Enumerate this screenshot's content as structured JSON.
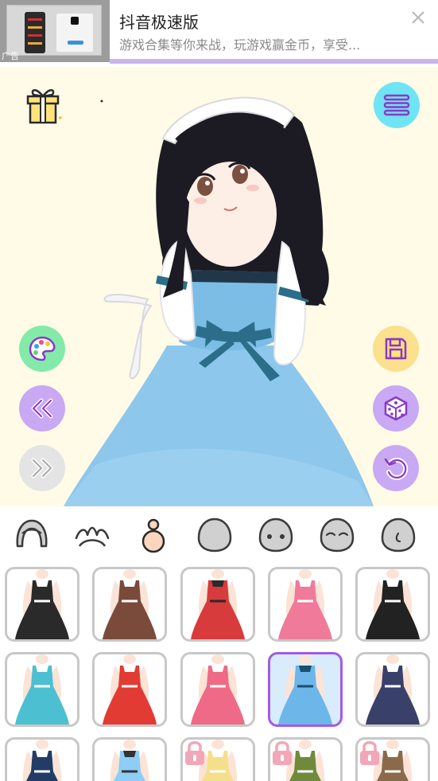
{
  "ad": {
    "tag": "广告",
    "title": "抖音极速版",
    "description": "游戏合集等你来战，玩游戏赢金币，享受..."
  },
  "icons": {
    "gift": "gift-icon",
    "menu": "hamburger-menu-icon",
    "palette": "palette-icon",
    "save": "floppy-disk-icon",
    "prev": "double-chevron-left-icon",
    "random": "dice-icon",
    "next": "double-chevron-right-icon",
    "undo": "undo-arrow-icon",
    "lock": "padlock-icon"
  },
  "colors": {
    "stage_background": "#fffbe7",
    "menu_button": "#6fe4f4",
    "palette_button": "#84eaa9",
    "save_button": "#fbe08d",
    "purple_button": "#c9a8f4",
    "disabled_button": "#e4e4e4",
    "selected_border": "#a35ae6",
    "lock": "#f1a7b7"
  },
  "categories": [
    {
      "name": "hair",
      "icon": "hair-icon",
      "selected": false
    },
    {
      "name": "accessory",
      "icon": "bunny-ears-icon",
      "selected": false
    },
    {
      "name": "body",
      "icon": "body-icon",
      "selected": true
    },
    {
      "name": "face",
      "icon": "face-blank-icon",
      "selected": false
    },
    {
      "name": "eyes",
      "icon": "face-eyes-icon",
      "selected": false
    },
    {
      "name": "expression",
      "icon": "face-closed-eyes-icon",
      "selected": false
    },
    {
      "name": "nose",
      "icon": "face-nose-icon",
      "selected": false
    }
  ],
  "outfits": [
    {
      "name": "black-bunny-outfit",
      "dress_color": "#2a2a2a",
      "accent": "#ffffff",
      "locked": false,
      "selected": false
    },
    {
      "name": "brown-bunny-outfit",
      "dress_color": "#7a4a3a",
      "accent": "#ffffff",
      "locked": false,
      "selected": false
    },
    {
      "name": "red-bunny-outfit",
      "dress_color": "#d83b3b",
      "accent": "#2a2a2a",
      "locked": false,
      "selected": false
    },
    {
      "name": "pink-maid-dress",
      "dress_color": "#f07a9a",
      "accent": "#ffffff",
      "locked": false,
      "selected": false
    },
    {
      "name": "black-gothic-dress",
      "dress_color": "#222222",
      "accent": "#ffffff",
      "locked": false,
      "selected": false
    },
    {
      "name": "teal-dress",
      "dress_color": "#4cc0d0",
      "accent": "#ffffff",
      "locked": false,
      "selected": false
    },
    {
      "name": "red-maid-dress",
      "dress_color": "#e23b34",
      "accent": "#ffffff",
      "locked": false,
      "selected": false
    },
    {
      "name": "pink-ribbon-dress",
      "dress_color": "#ef6a86",
      "accent": "#ffffff",
      "locked": false,
      "selected": false
    },
    {
      "name": "blue-maid-dress",
      "dress_color": "#6cb6ea",
      "accent": "#1d4f6e",
      "locked": false,
      "selected": true
    },
    {
      "name": "navy-sailor-uniform",
      "dress_color": "#39406a",
      "accent": "#ffffff",
      "locked": false,
      "selected": false
    },
    {
      "name": "navy-blazer-uniform",
      "dress_color": "#233c66",
      "accent": "#ffffff",
      "locked": false,
      "selected": false
    },
    {
      "name": "light-blue-top",
      "dress_color": "#8ecdf5",
      "accent": "#333333",
      "locked": false,
      "selected": false
    },
    {
      "name": "yellow-top",
      "dress_color": "#f6df8a",
      "accent": "#ffffff",
      "locked": true,
      "selected": false
    },
    {
      "name": "green-olive-outfit",
      "dress_color": "#6f8a3a",
      "accent": "#ffffff",
      "locked": true,
      "selected": false
    },
    {
      "name": "brown-coat-outfit",
      "dress_color": "#8a6a4a",
      "accent": "#ffffff",
      "locked": true,
      "selected": false
    }
  ]
}
